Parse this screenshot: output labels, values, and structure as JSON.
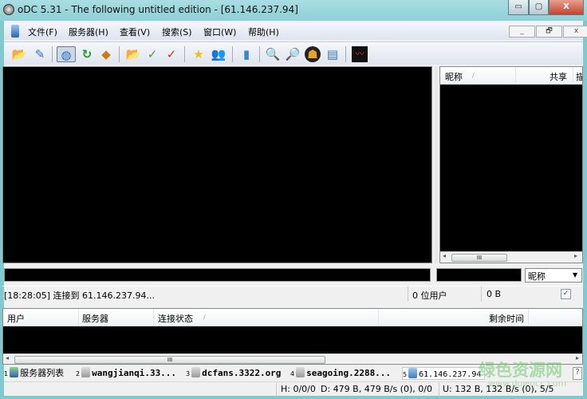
{
  "window": {
    "title": "oDC 5.31 - The following untitled edition - [61.146.237.94]",
    "min": "▭",
    "max": "▢",
    "close": "X"
  },
  "menu": {
    "items": [
      "文件(F)",
      "服务器(H)",
      "查看(V)",
      "搜索(S)",
      "窗口(W)",
      "帮助(H)"
    ],
    "mdi_min": "_",
    "mdi_restore": "🗗",
    "mdi_close": "x"
  },
  "toolbar": {
    "icons": [
      "open-folder-icon",
      "edit-icon",
      "connect-globe-icon",
      "refresh-icon",
      "redirect-icon",
      "open-list-icon",
      "finished-icon",
      "finished-uploads-icon",
      "favorite-star-icon",
      "favorite-users-icon",
      "notepad-icon",
      "search-icon",
      "spy-icon",
      "adl-search-icon",
      "search-spy-icon",
      "network-stats-icon"
    ]
  },
  "userlist": {
    "col_nick": "昵称",
    "sort_arrow": "/",
    "col_share": "共享",
    "col_more": "描",
    "scroll_grip": "III"
  },
  "input": {
    "chat_value": "",
    "filter_value": "",
    "select_value": "昵称",
    "select_arrow": "▼"
  },
  "status": {
    "message": "[18:28:05] 连接到 61.146.237.94...",
    "users": "0 位用户",
    "share": "0 B",
    "checkbox": "✓"
  },
  "transfers": {
    "cols": [
      "用户",
      "服务器",
      "连接状态",
      "剩余时间"
    ],
    "sort_arrow": "/",
    "scroll_grip": "III",
    "left": "◂",
    "right": "▸"
  },
  "tabs": [
    {
      "num": "1",
      "label": "服务器列表"
    },
    {
      "num": "2",
      "label": "wangjianqi.33..."
    },
    {
      "num": "3",
      "label": "dcfans.3322.org"
    },
    {
      "num": "4",
      "label": "seagoing.2288..."
    },
    {
      "num": "5",
      "label": "61.146.237.94"
    }
  ],
  "help": "?",
  "statusbar": {
    "hubs": "H: 0/0/0",
    "download": "D: 479 B, 479 B/s (0), 0/0",
    "upload": "U: 132 B, 132 B/s (0), 5/5"
  },
  "watermark": {
    "cn": "绿色资源网",
    "url": "www.downcc.com"
  }
}
